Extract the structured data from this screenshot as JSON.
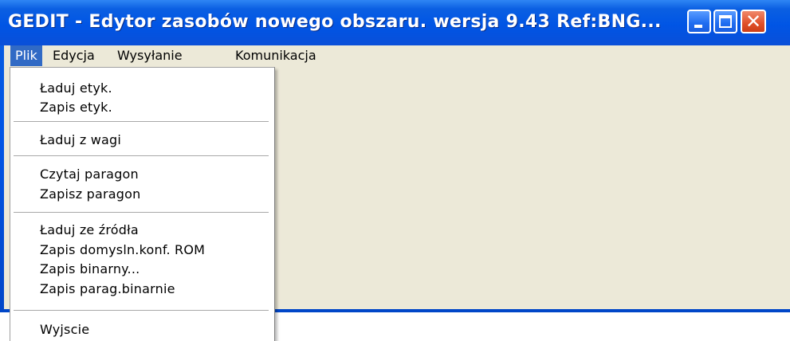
{
  "window": {
    "title": "GEDIT - Edytor zasobów nowego obszaru.   wersja  9.43 Ref:BNG...",
    "buttons": {
      "minimize_icon": "minimize-icon",
      "maximize_icon": "maximize-icon",
      "close_icon": "close-icon",
      "close_glyph": "✕"
    }
  },
  "menubar": {
    "items": [
      {
        "label": "Plik",
        "active": true
      },
      {
        "label": "Edycja"
      },
      {
        "label": "Wysyłanie"
      },
      {
        "label": "Komunikacja"
      }
    ]
  },
  "dropdown": {
    "items": [
      {
        "label": "Ładuj etyk."
      },
      {
        "label": "Zapis etyk."
      },
      {
        "label": "Ładuj z wagi"
      },
      {
        "label": "Czytaj paragon"
      },
      {
        "label": "Zapisz paragon"
      },
      {
        "label": "Ładuj ze źródła"
      },
      {
        "label": "Zapis domysln.konf. ROM"
      },
      {
        "label": "Zapis binarny..."
      },
      {
        "label": "Zapis parag.binarnie"
      },
      {
        "label": "Wyjscie"
      }
    ]
  },
  "colors": {
    "titlebar": "#0055e5",
    "menu_highlight": "#316ac5",
    "client_bg": "#ece9d8",
    "close_button": "#e0502a"
  }
}
